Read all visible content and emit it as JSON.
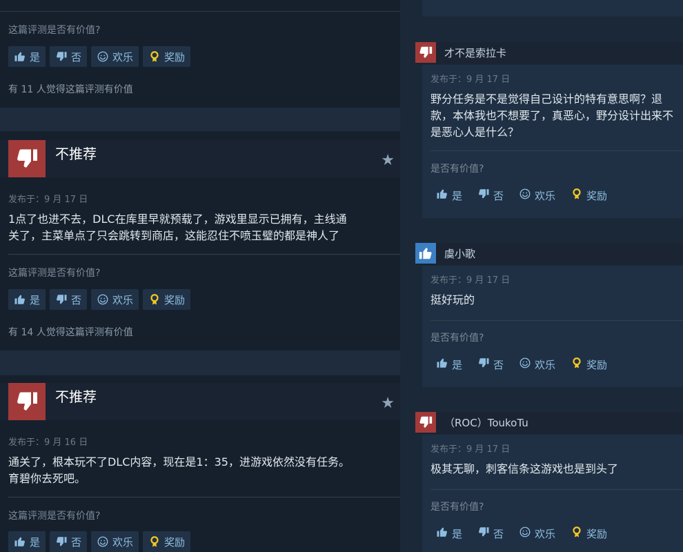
{
  "left": {
    "top": {
      "ask": "这篇评测是否有价值?",
      "helpful": "有 11 人觉得这篇评测有价值"
    },
    "reviews": [
      {
        "verdict": "不推荐",
        "posted": "发布于：9 月 17 日",
        "line1": "1点了也进不去，DLC在库里早就预载了，游戏里显示已拥有，主线通",
        "line2": "关了，主菜单点了只会跳转到商店，这能忍住不喷玉璧的都是神人了",
        "ask": "这篇评测是否有价值?",
        "helpful": "有 14 人觉得这篇评测有价值"
      },
      {
        "verdict": "不推荐",
        "posted": "发布于：9 月 16 日",
        "line1": "通关了，根本玩不了DLC内容，现在是1：35，进游戏依然没有任务。",
        "line2": "育碧你去死吧。",
        "ask": "这篇评测是否有价值?"
      }
    ]
  },
  "buttons": {
    "yes": "是",
    "no": "否",
    "funny": "欢乐",
    "award": "奖励"
  },
  "right": {
    "comments": [
      {
        "user": "才不是索拉卡",
        "posted": "发布于：9 月 17 日",
        "line1": "野分任务是不是觉得自己设计的特有意思啊？退",
        "line2": "款，本体我也不想要了，真恶心，野分设计出来不",
        "line3": "是恶心人是什么？",
        "ask": "是否有价值?"
      },
      {
        "user": "虞小歌",
        "posted": "发布于：9 月 17 日",
        "line1": "挺好玩的",
        "ask": "是否有价值?"
      },
      {
        "user": "（ROC）ToukoTu",
        "posted": "发布于：9 月 17 日",
        "line1": "极其无聊，刺客信条这游戏也是到头了",
        "ask": "是否有价值?"
      }
    ]
  },
  "colors": {
    "thumbs_down": "#a33a3a",
    "thumbs_up": "#3b7fc4",
    "award_gold": "#f3c623",
    "link_blue": "#8fbde0"
  },
  "icons": [
    "thumbs-up-icon",
    "thumbs-down-icon",
    "smiley-icon",
    "award-icon",
    "star-icon"
  ]
}
